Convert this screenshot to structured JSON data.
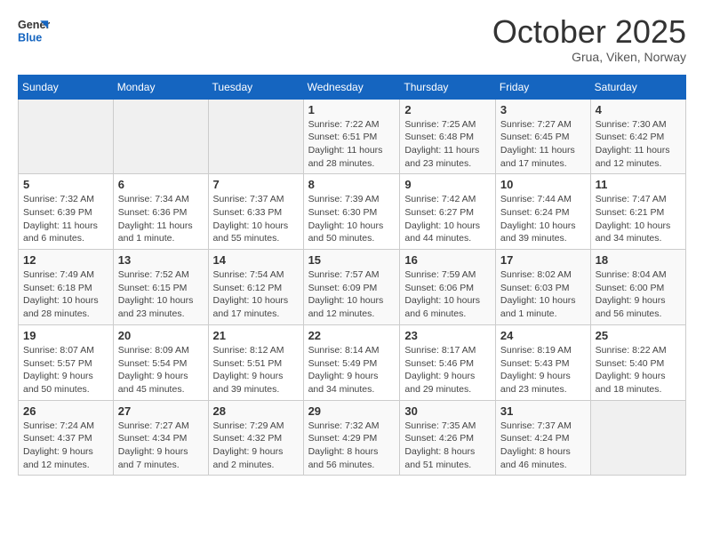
{
  "header": {
    "logo_line1": "General",
    "logo_line2": "Blue",
    "title": "October 2025",
    "subtitle": "Grua, Viken, Norway"
  },
  "weekdays": [
    "Sunday",
    "Monday",
    "Tuesday",
    "Wednesday",
    "Thursday",
    "Friday",
    "Saturday"
  ],
  "weeks": [
    [
      {
        "day": "",
        "info": ""
      },
      {
        "day": "",
        "info": ""
      },
      {
        "day": "",
        "info": ""
      },
      {
        "day": "1",
        "info": "Sunrise: 7:22 AM\nSunset: 6:51 PM\nDaylight: 11 hours and 28 minutes."
      },
      {
        "day": "2",
        "info": "Sunrise: 7:25 AM\nSunset: 6:48 PM\nDaylight: 11 hours and 23 minutes."
      },
      {
        "day": "3",
        "info": "Sunrise: 7:27 AM\nSunset: 6:45 PM\nDaylight: 11 hours and 17 minutes."
      },
      {
        "day": "4",
        "info": "Sunrise: 7:30 AM\nSunset: 6:42 PM\nDaylight: 11 hours and 12 minutes."
      }
    ],
    [
      {
        "day": "5",
        "info": "Sunrise: 7:32 AM\nSunset: 6:39 PM\nDaylight: 11 hours and 6 minutes."
      },
      {
        "day": "6",
        "info": "Sunrise: 7:34 AM\nSunset: 6:36 PM\nDaylight: 11 hours and 1 minute."
      },
      {
        "day": "7",
        "info": "Sunrise: 7:37 AM\nSunset: 6:33 PM\nDaylight: 10 hours and 55 minutes."
      },
      {
        "day": "8",
        "info": "Sunrise: 7:39 AM\nSunset: 6:30 PM\nDaylight: 10 hours and 50 minutes."
      },
      {
        "day": "9",
        "info": "Sunrise: 7:42 AM\nSunset: 6:27 PM\nDaylight: 10 hours and 44 minutes."
      },
      {
        "day": "10",
        "info": "Sunrise: 7:44 AM\nSunset: 6:24 PM\nDaylight: 10 hours and 39 minutes."
      },
      {
        "day": "11",
        "info": "Sunrise: 7:47 AM\nSunset: 6:21 PM\nDaylight: 10 hours and 34 minutes."
      }
    ],
    [
      {
        "day": "12",
        "info": "Sunrise: 7:49 AM\nSunset: 6:18 PM\nDaylight: 10 hours and 28 minutes."
      },
      {
        "day": "13",
        "info": "Sunrise: 7:52 AM\nSunset: 6:15 PM\nDaylight: 10 hours and 23 minutes."
      },
      {
        "day": "14",
        "info": "Sunrise: 7:54 AM\nSunset: 6:12 PM\nDaylight: 10 hours and 17 minutes."
      },
      {
        "day": "15",
        "info": "Sunrise: 7:57 AM\nSunset: 6:09 PM\nDaylight: 10 hours and 12 minutes."
      },
      {
        "day": "16",
        "info": "Sunrise: 7:59 AM\nSunset: 6:06 PM\nDaylight: 10 hours and 6 minutes."
      },
      {
        "day": "17",
        "info": "Sunrise: 8:02 AM\nSunset: 6:03 PM\nDaylight: 10 hours and 1 minute."
      },
      {
        "day": "18",
        "info": "Sunrise: 8:04 AM\nSunset: 6:00 PM\nDaylight: 9 hours and 56 minutes."
      }
    ],
    [
      {
        "day": "19",
        "info": "Sunrise: 8:07 AM\nSunset: 5:57 PM\nDaylight: 9 hours and 50 minutes."
      },
      {
        "day": "20",
        "info": "Sunrise: 8:09 AM\nSunset: 5:54 PM\nDaylight: 9 hours and 45 minutes."
      },
      {
        "day": "21",
        "info": "Sunrise: 8:12 AM\nSunset: 5:51 PM\nDaylight: 9 hours and 39 minutes."
      },
      {
        "day": "22",
        "info": "Sunrise: 8:14 AM\nSunset: 5:49 PM\nDaylight: 9 hours and 34 minutes."
      },
      {
        "day": "23",
        "info": "Sunrise: 8:17 AM\nSunset: 5:46 PM\nDaylight: 9 hours and 29 minutes."
      },
      {
        "day": "24",
        "info": "Sunrise: 8:19 AM\nSunset: 5:43 PM\nDaylight: 9 hours and 23 minutes."
      },
      {
        "day": "25",
        "info": "Sunrise: 8:22 AM\nSunset: 5:40 PM\nDaylight: 9 hours and 18 minutes."
      }
    ],
    [
      {
        "day": "26",
        "info": "Sunrise: 7:24 AM\nSunset: 4:37 PM\nDaylight: 9 hours and 12 minutes."
      },
      {
        "day": "27",
        "info": "Sunrise: 7:27 AM\nSunset: 4:34 PM\nDaylight: 9 hours and 7 minutes."
      },
      {
        "day": "28",
        "info": "Sunrise: 7:29 AM\nSunset: 4:32 PM\nDaylight: 9 hours and 2 minutes."
      },
      {
        "day": "29",
        "info": "Sunrise: 7:32 AM\nSunset: 4:29 PM\nDaylight: 8 hours and 56 minutes."
      },
      {
        "day": "30",
        "info": "Sunrise: 7:35 AM\nSunset: 4:26 PM\nDaylight: 8 hours and 51 minutes."
      },
      {
        "day": "31",
        "info": "Sunrise: 7:37 AM\nSunset: 4:24 PM\nDaylight: 8 hours and 46 minutes."
      },
      {
        "day": "",
        "info": ""
      }
    ]
  ]
}
